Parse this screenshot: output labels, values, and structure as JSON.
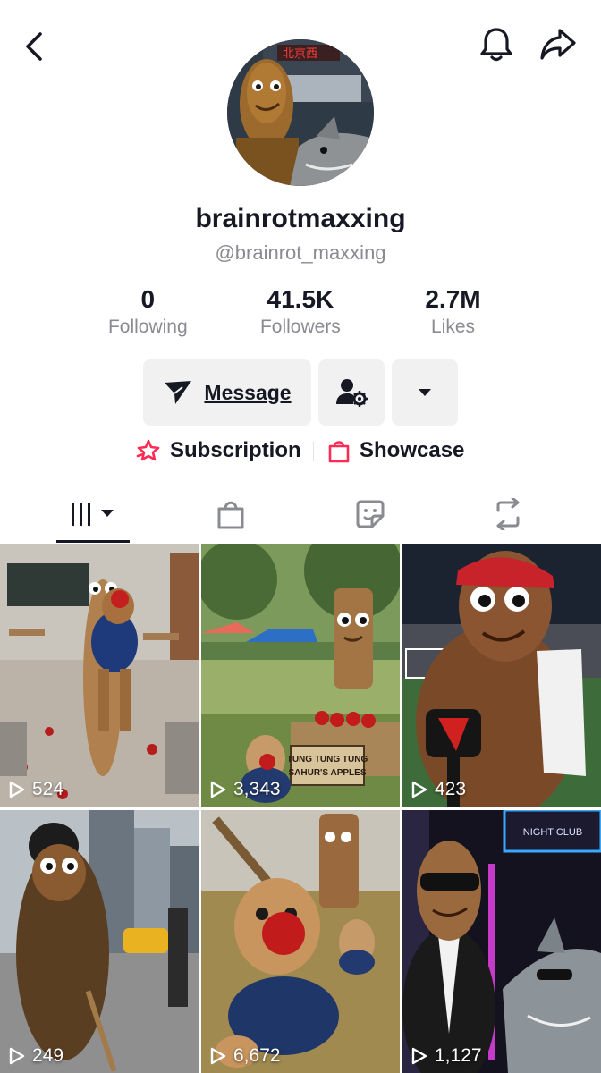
{
  "profile": {
    "display_name": "brainrotmaxxing",
    "handle": "@brainrot_maxxing"
  },
  "stats": [
    {
      "value": "0",
      "label": "Following"
    },
    {
      "value": "41.5K",
      "label": "Followers"
    },
    {
      "value": "2.7M",
      "label": "Likes"
    }
  ],
  "actions": {
    "message_label": "Message"
  },
  "links": {
    "subscription_label": "Subscription",
    "showcase_label": "Showcase"
  },
  "tabs": [
    {
      "icon": "grid-videos-icon"
    },
    {
      "icon": "shopping-bag-icon"
    },
    {
      "icon": "sticker-icon"
    },
    {
      "icon": "repost-icon"
    }
  ],
  "videos": [
    {
      "views": "524"
    },
    {
      "views": "3,343"
    },
    {
      "views": "423"
    },
    {
      "views": "249"
    },
    {
      "views": "6,672"
    },
    {
      "views": "1,127"
    }
  ],
  "thumbnail_text": {
    "market_sign": "TUNG TUNG TUNG SAHUR'S APPLES",
    "club_sign": "NIGHT CLUB"
  },
  "colors": {
    "accent": "#FE2C55",
    "text": "#161823",
    "secondary": "#8A8B91",
    "button_bg": "#F1F1F2"
  }
}
